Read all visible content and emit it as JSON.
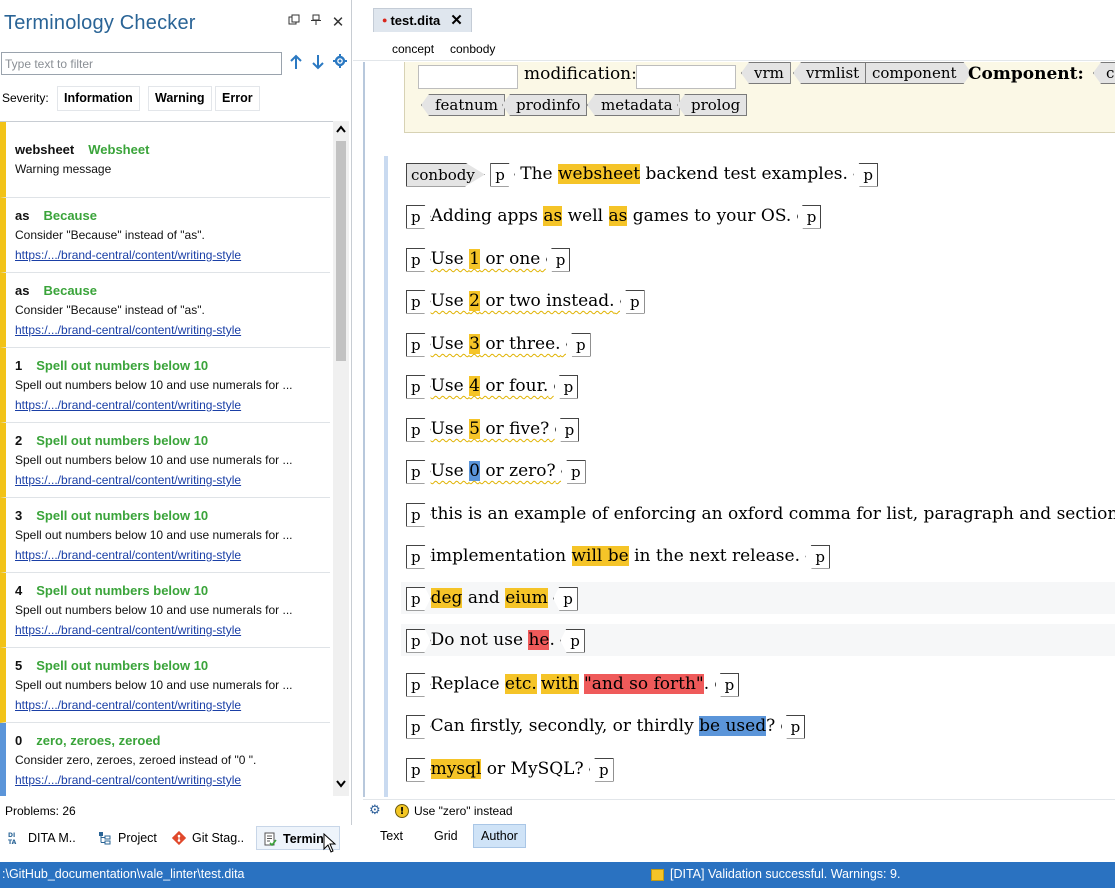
{
  "panel": {
    "title": "Terminology Checker",
    "filter_placeholder": "Type text to filter",
    "severity_label": "Severity:",
    "severity_buttons": [
      "Information",
      "Warning",
      "Error"
    ],
    "problems_label": "Problems:",
    "problems_count": "26"
  },
  "problems": [
    {
      "word": "websheet",
      "rule": "Websheet",
      "message": "Warning message",
      "link": ""
    },
    {
      "word": "as",
      "rule": "Because",
      "message": "Consider \"Because\" instead of \"as\".",
      "link": "https:/.../brand-central/content/writing-style"
    },
    {
      "word": "as",
      "rule": "Because",
      "message": "Consider \"Because\" instead of \"as\".",
      "link": "https:/.../brand-central/content/writing-style"
    },
    {
      "word": "1",
      "rule": "Spell out numbers below 10",
      "message": "Spell out numbers below 10 and use numerals for ...",
      "link": "https:/.../brand-central/content/writing-style"
    },
    {
      "word": "2",
      "rule": "Spell out numbers below 10",
      "message": "Spell out numbers below 10 and use numerals for ...",
      "link": "https:/.../brand-central/content/writing-style"
    },
    {
      "word": "3",
      "rule": "Spell out numbers below 10",
      "message": "Spell out numbers below 10 and use numerals for ...",
      "link": "https:/.../brand-central/content/writing-style"
    },
    {
      "word": "4",
      "rule": "Spell out numbers below 10",
      "message": "Spell out numbers below 10 and use numerals for ...",
      "link": "https:/.../brand-central/content/writing-style"
    },
    {
      "word": "5",
      "rule": "Spell out numbers below 10",
      "message": "Spell out numbers below 10 and use numerals for ...",
      "link": "https:/.../brand-central/content/writing-style"
    },
    {
      "word": "0",
      "rule": "zero, zeroes, zeroed",
      "message": "Consider zero, zeroes, zeroed instead of \"0 \".",
      "link": "https:/.../brand-central/content/writing-style"
    }
  ],
  "left_tabs": [
    "DITA M..",
    "Project",
    "Git Stag..",
    "Termin"
  ],
  "editor": {
    "tab_name": "test.dita",
    "breadcrumb": [
      "concept",
      "conbody"
    ],
    "prolog": {
      "modification_label": "modification:",
      "component_label": "Component:",
      "row1_tags": [
        "vrm",
        "vrmlist",
        "component"
      ],
      "row1_cut": "cc",
      "row2_tags": [
        "featnum",
        "prodinfo",
        "metadata",
        "prolog"
      ]
    },
    "conbody_tag": "conbody",
    "p_tag": "p",
    "lines": {
      "l1": [
        "The ",
        "websheet",
        " backend test examples."
      ],
      "l2": [
        "Adding apps ",
        "as",
        " well ",
        "as",
        " games to your OS."
      ],
      "l3": [
        "Use ",
        "1",
        " or one"
      ],
      "l4": [
        "Use ",
        "2",
        " or two instead."
      ],
      "l5": [
        "Use ",
        "3",
        " or three."
      ],
      "l6": [
        "Use ",
        "4",
        " or four."
      ],
      "l7": [
        "Use ",
        "5",
        " or five?"
      ],
      "l8": [
        "Use ",
        "0",
        " or zero?"
      ],
      "l9": [
        "this is an example of enforcing an oxford comma for list, paragraph and section"
      ],
      "l10": [
        "implementation ",
        "will be",
        " in the next release."
      ],
      "l11": [
        "deg",
        " and ",
        "eium"
      ],
      "l12": [
        "Do not use ",
        "he",
        "."
      ],
      "l13": [
        "Replace ",
        "etc.",
        " ",
        "with",
        " ",
        "\"and so forth\"",
        "."
      ],
      "l14": [
        "Can firstly, secondly, or thirdly ",
        "be used",
        "?"
      ],
      "l15": [
        "mysql",
        " or MySQL?"
      ]
    },
    "status_message": "Use \"zero\" instead",
    "mode_tabs": [
      "Text",
      "Grid",
      "Author"
    ]
  },
  "status_bar": {
    "path": ":\\GitHub_documentation\\vale_linter\\test.dita",
    "validation": "[DITA] Validation successful. Warnings: 9."
  },
  "colors": {
    "accent": "#2a72c1",
    "warning": "#f5c428",
    "error": "#ef5a5a",
    "info": "#5b95d9",
    "rule_green": "#3aa43a"
  }
}
